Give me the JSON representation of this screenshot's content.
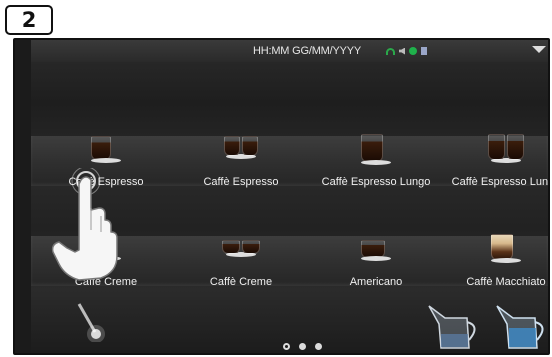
{
  "step_badge": "2",
  "status_bar": {
    "datetime": "HH:MM GG/MM/YYYY",
    "icons": [
      "wifi-icon",
      "speaker-icon",
      "status-green-icon",
      "usb-icon"
    ],
    "menu_icon": "triangle-down-icon"
  },
  "drinks_row1": [
    {
      "label": "Caffè Espresso",
      "style": "dark"
    },
    {
      "label": "Caffè Espresso",
      "style": "dark-double"
    },
    {
      "label": "Caffè Espresso Lungo",
      "style": "dark"
    },
    {
      "label": "Caffè Espresso Lungo",
      "style": "dark-double"
    }
  ],
  "drinks_row2": [
    {
      "label": "Caffè Creme",
      "style": "dark"
    },
    {
      "label": "Caffè Creme",
      "style": "dark-double"
    },
    {
      "label": "Americano",
      "style": "dark"
    },
    {
      "label": "Caffè Macchiato",
      "style": "light"
    }
  ],
  "bottom": {
    "steam_wand_icon": "steam-wand-icon",
    "pitchers": [
      "milk-pitcher-icon",
      "water-pitcher-icon"
    ]
  },
  "pagination": {
    "pages": 3,
    "active": 0
  }
}
